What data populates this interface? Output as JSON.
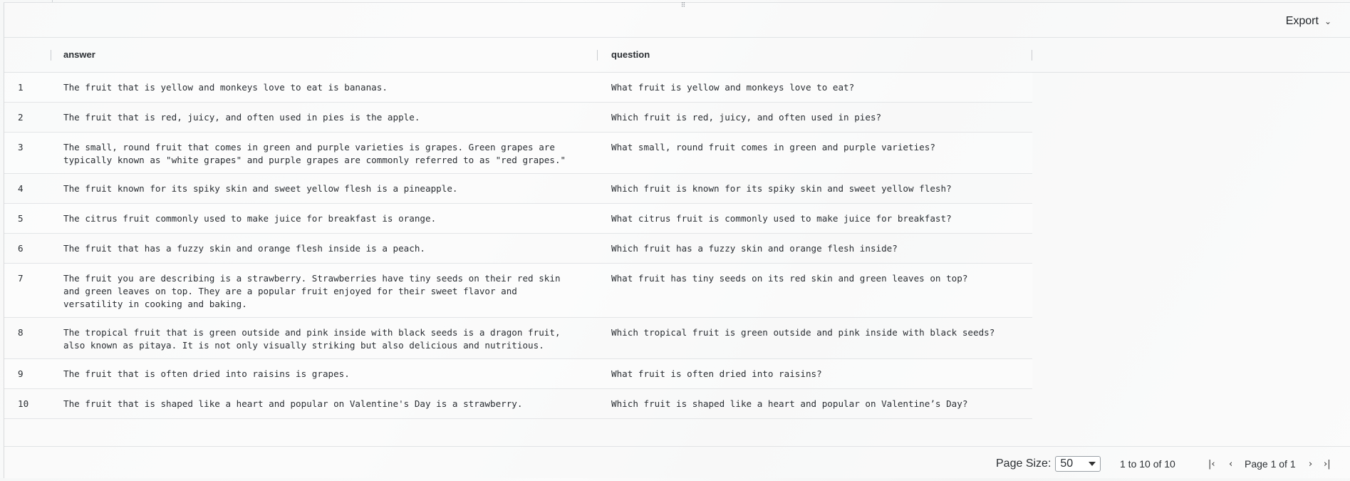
{
  "toolbar": {
    "export_label": "Export"
  },
  "grid": {
    "columns": {
      "answer": "answer",
      "question": "question"
    },
    "rows": [
      {
        "index": "1",
        "answer": "The fruit that is yellow and monkeys love to eat is bananas.",
        "question": "What fruit is yellow and monkeys love to eat?"
      },
      {
        "index": "2",
        "answer": "The fruit that is red, juicy, and often used in pies is the apple.",
        "question": "Which fruit is red, juicy, and often used in pies?"
      },
      {
        "index": "3",
        "answer": "The small, round fruit that comes in green and purple varieties is grapes. Green grapes are\ntypically known as \"white grapes\" and purple grapes are commonly referred to as \"red grapes.\"",
        "question": "What small, round fruit comes in green and purple varieties?"
      },
      {
        "index": "4",
        "answer": "The fruit known for its spiky skin and sweet yellow flesh is a pineapple.",
        "question": "Which fruit is known for its spiky skin and sweet yellow flesh?"
      },
      {
        "index": "5",
        "answer": "The citrus fruit commonly used to make juice for breakfast is orange.",
        "question": "What citrus fruit is commonly used to make juice for breakfast?"
      },
      {
        "index": "6",
        "answer": "The fruit that has a fuzzy skin and orange flesh inside is a peach.",
        "question": "Which fruit has a fuzzy skin and orange flesh inside?"
      },
      {
        "index": "7",
        "answer": "The fruit you are describing is a strawberry. Strawberries have tiny seeds on their red skin\nand green leaves on top. They are a popular fruit enjoyed for their sweet flavor and\nversatility in cooking and baking.",
        "question": "What fruit has tiny seeds on its red skin and green leaves on top?"
      },
      {
        "index": "8",
        "answer": "The tropical fruit that is green outside and pink inside with black seeds is a dragon fruit,\nalso known as pitaya. It is not only visually striking but also delicious and nutritious.",
        "question": "Which tropical fruit is green outside and pink inside with black seeds?"
      },
      {
        "index": "9",
        "answer": "The fruit that is often dried into raisins is grapes.",
        "question": "What fruit is often dried into raisins?"
      },
      {
        "index": "10",
        "answer": "The fruit that is shaped like a heart and popular on Valentine's Day is a strawberry.",
        "question": "Which fruit is shaped like a heart and popular on Valentine’s Day?"
      }
    ]
  },
  "footer": {
    "page_size_label": "Page Size:",
    "page_size_value": "50",
    "range_text": "1 to 10 of 10",
    "page_text": "Page 1 of 1"
  }
}
